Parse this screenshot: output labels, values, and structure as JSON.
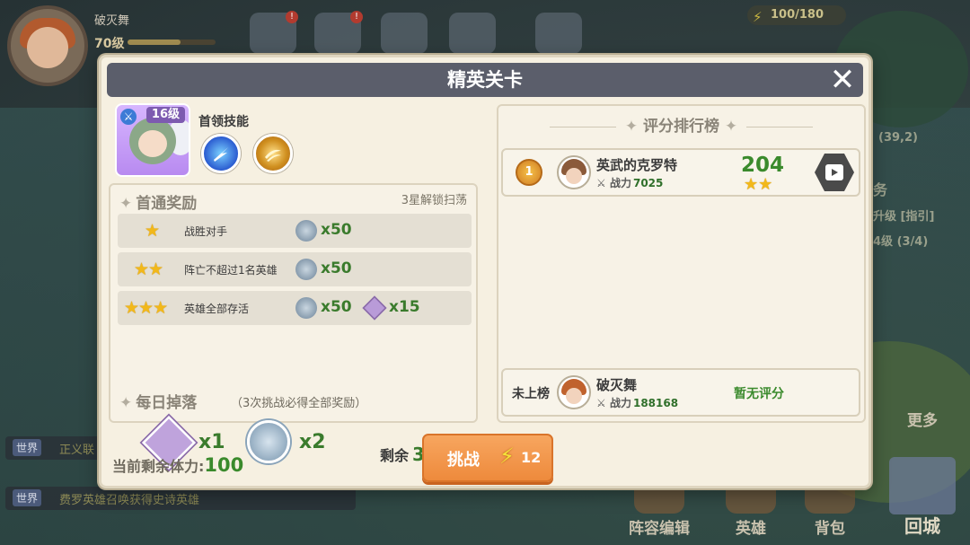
{
  "hud": {
    "player_name": "破灭舞",
    "player_level": "70级",
    "level_progress": 0.6,
    "energy": "100/180",
    "map_coords": "(39,2)",
    "side_texts": [
      "务",
      "升级 [指引]",
      "4级 (3/4)"
    ],
    "more_label": "更多",
    "bottom_buttons": [
      "阵容编辑",
      "英雄",
      "背包"
    ],
    "castle_label": "回城",
    "chat": [
      {
        "channel": "世界",
        "text": "正义联"
      },
      {
        "channel": "世界",
        "text": "费罗英雄召唤获得史诗英雄"
      }
    ]
  },
  "modal": {
    "title": "精英关卡",
    "boss": {
      "level_tag": "16级",
      "skill_label": "首领技能",
      "skills": [
        "lightning-skill-icon",
        "golden-slash-skill-icon"
      ]
    },
    "first_clear": {
      "title": "首通奖励",
      "unlock_note": "3星解锁扫荡",
      "rows": [
        {
          "stars": "★",
          "condition": "战胜对手",
          "items": [
            {
              "icon": "hero-orb-icon",
              "qty": "x50"
            }
          ]
        },
        {
          "stars": "★★",
          "condition": "阵亡不超过1名英雄",
          "items": [
            {
              "icon": "hero-orb-icon",
              "qty": "x50"
            }
          ]
        },
        {
          "stars": "★★★",
          "condition": "英雄全部存活",
          "items": [
            {
              "icon": "hero-orb-icon",
              "qty": "x50"
            },
            {
              "icon": "hero-shard-icon",
              "qty": "x15"
            }
          ]
        }
      ]
    },
    "daily_drop": {
      "title": "每日掉落",
      "note": "（3次挑战必得全部奖励）",
      "items": [
        {
          "icon": "hero-shard-icon",
          "qty": "x1"
        },
        {
          "icon": "hero-orb-icon",
          "qty": "x2"
        }
      ],
      "remain_label": "剩余",
      "remain_value": "3",
      "plus_label": "+"
    },
    "ranking": {
      "title": "评分排行榜",
      "entries": [
        {
          "rank": "1",
          "name": "英武的克罗特",
          "power_label": "战力",
          "power": "7025",
          "score": "204",
          "stars": "★★"
        }
      ],
      "me": {
        "rank_label": "未上榜",
        "name": "破灭舞",
        "power_label": "战力",
        "power": "188168",
        "score_label": "暂无评分"
      }
    },
    "footer": {
      "stamina_label": "当前剩余体力:",
      "stamina_value": "100",
      "challenge_label": "挑战",
      "challenge_cost": "12"
    },
    "colors": {
      "accent_green": "#3a8a2c",
      "button_orange": "#ee8a3c",
      "title_bar": "#5b5e6b"
    }
  }
}
